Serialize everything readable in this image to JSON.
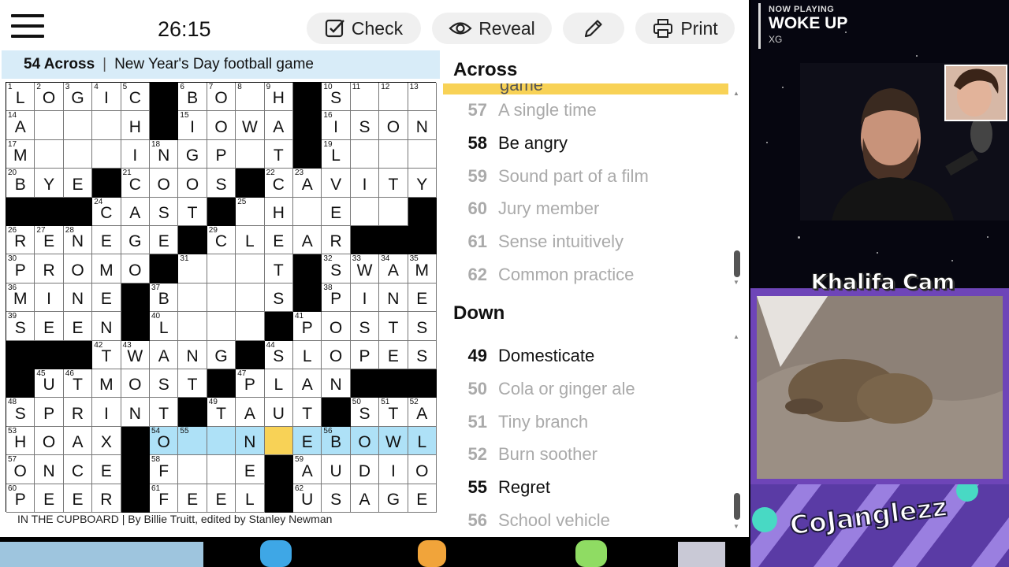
{
  "toolbar": {
    "timer": "26:15",
    "check_label": "Check",
    "reveal_label": "Reveal",
    "print_label": "Print"
  },
  "current_clue": {
    "number_label": "54 Across",
    "text": "New Year's Day football game"
  },
  "grid": {
    "rows": [
      "LOGIC#BO.H#S...",
      "A....H#IOWA#ISON",
      "M...INGP.T#L...",
      "BYE#COOS#CAVITY",
      "###CAST#.H.E..#",
      "RENEGE#CLEAR###",
      "PROMO#...T#SWAM",
      "MINE#B...S#PINE",
      "SEEN#L..#POSTS",
      "###TWANG#SLOPES",
      "#UTMOST#PLAN###",
      "SPRINT#TAUT#STA",
      "HOAX#O..NEBOWL",
      "ONCE#F..E#AUDIO",
      "PEER#FEEL#USAGE"
    ],
    "numbers": {
      "0,0": "1",
      "0,1": "2",
      "0,2": "3",
      "0,3": "4",
      "0,4": "5",
      "0,6": "6",
      "0,7": "7",
      "0,8": "8",
      "0,9": "9",
      "0,11": "10",
      "0,12": "11",
      "0,13": "12",
      "0,14": "13",
      "1,0": "14",
      "1,6": "15",
      "1,11": "16",
      "2,0": "17",
      "2,5": "18",
      "2,11": "19",
      "3,0": "20",
      "3,4": "21",
      "3,9": "22",
      "3,10": "23",
      "4,3": "24",
      "4,8": "25",
      "5,0": "26",
      "5,1": "27",
      "5,2": "28",
      "5,7": "29",
      "6,0": "30",
      "6,6": "31",
      "6,11": "32",
      "6,12": "33",
      "6,13": "34",
      "6,14": "35",
      "7,0": "36",
      "7,5": "37",
      "7,11": "38",
      "8,0": "39",
      "8,5": "40",
      "8,10": "41",
      "9,3": "42",
      "9,4": "43",
      "9,9": "44",
      "10,1": "45",
      "10,2": "46",
      "10,8": "47",
      "11,0": "48",
      "11,7": "49",
      "11,12": "50",
      "11,13": "51",
      "11,14": "52",
      "12,0": "53",
      "12,5": "54",
      "12,6": "55",
      "12,11": "56",
      "13,0": "57",
      "13,5": "58",
      "13,10": "59",
      "14,0": "60",
      "14,5": "61",
      "14,10": "62"
    },
    "highlight_row": 12,
    "highlight_cols": [
      5,
      6,
      7,
      8,
      9,
      10,
      11,
      12,
      13,
      14
    ],
    "cursor": "12,9"
  },
  "byline": "IN THE CUPBOARD | By Billie Truitt, edited by Stanley Newman",
  "across": {
    "title": "Across",
    "partial_text": "game",
    "clues": [
      {
        "num": "57",
        "text": "A single time",
        "active": false
      },
      {
        "num": "58",
        "text": "Be angry",
        "active": true
      },
      {
        "num": "59",
        "text": "Sound part of a film",
        "active": false
      },
      {
        "num": "60",
        "text": "Jury member",
        "active": false
      },
      {
        "num": "61",
        "text": "Sense intuitively",
        "active": false
      },
      {
        "num": "62",
        "text": "Common practice",
        "active": false
      }
    ]
  },
  "down": {
    "title": "Down",
    "clues": [
      {
        "num": "49",
        "text": "Domesticate",
        "active": true
      },
      {
        "num": "50",
        "text": "Cola or ginger ale",
        "active": false
      },
      {
        "num": "51",
        "text": "Tiny branch",
        "active": false
      },
      {
        "num": "52",
        "text": "Burn soother",
        "active": false
      },
      {
        "num": "55",
        "text": "Regret",
        "active": true
      },
      {
        "num": "56",
        "text": "School vehicle",
        "active": false
      }
    ]
  },
  "stream": {
    "now_playing_label": "NOW PLAYING",
    "song_title": "WOKE UP",
    "artist": "XG",
    "cam_title": "Khalifa Cam",
    "banner": "CoJanglezz"
  },
  "colors": {
    "highlight": "#aee1f7",
    "cursor": "#f8d256",
    "cluebar": "#d8ecf8",
    "overlay_purple": "#5b3aa6"
  }
}
